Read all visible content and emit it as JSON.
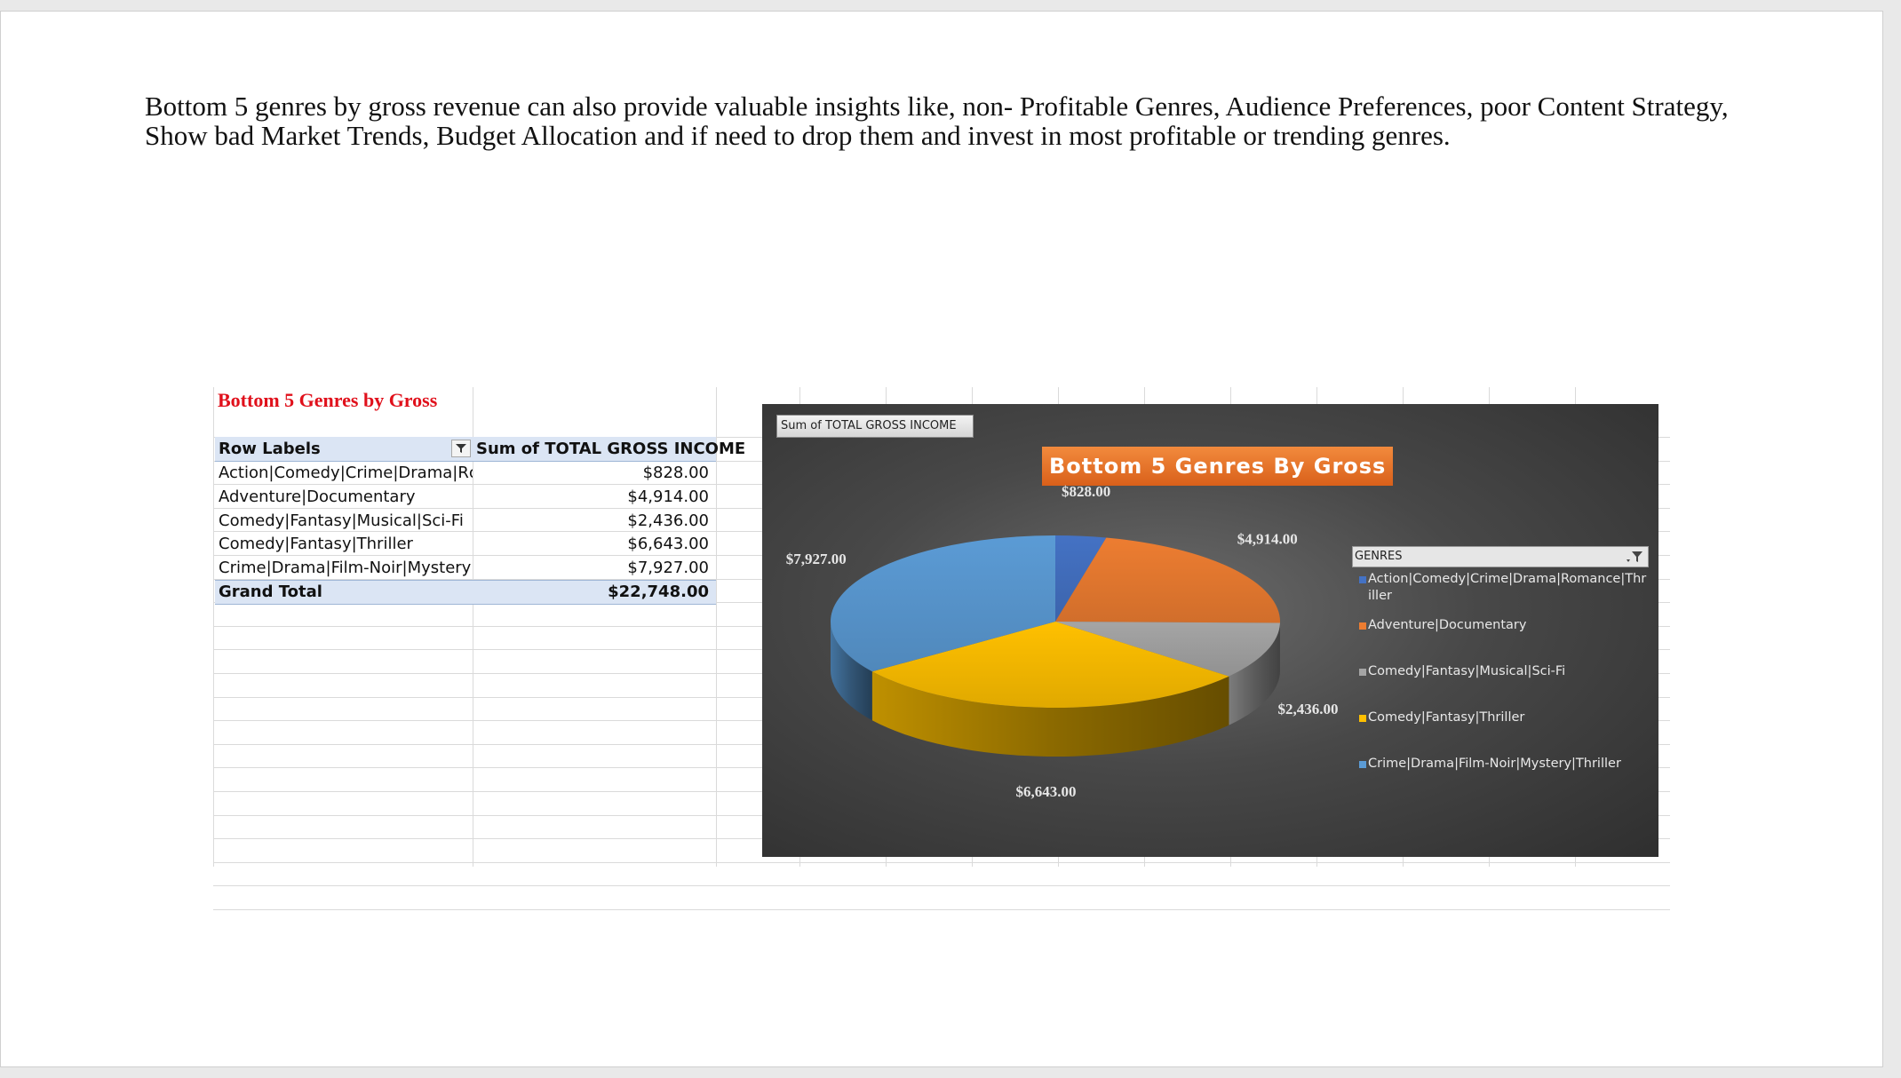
{
  "document": {
    "paragraph": "Bottom 5 genres by gross revenue can also provide valuable insights like, non- Profitable Genres, Audience Preferences, poor Content Strategy, Show bad Market Trends, Budget Allocation and if need to drop them and invest in most profitable or trending genres."
  },
  "pivot": {
    "title": "Bottom 5 Genres by Gross",
    "header": {
      "row_labels": "Row Labels",
      "value_col": "Sum of TOTAL GROSS INCOME"
    },
    "rows": [
      {
        "label": "Action|Comedy|Crime|Drama|Rc",
        "value": "$828.00"
      },
      {
        "label": "Adventure|Documentary",
        "value": "$4,914.00"
      },
      {
        "label": "Comedy|Fantasy|Musical|Sci-Fi",
        "value": "$2,436.00"
      },
      {
        "label": "Comedy|Fantasy|Thriller",
        "value": "$6,643.00"
      },
      {
        "label": "Crime|Drama|Film-Noir|Mystery",
        "value": "$7,927.00"
      }
    ],
    "total": {
      "label": "Grand Total",
      "value": "$22,748.00"
    }
  },
  "chart_data": {
    "type": "pie",
    "title": "Bottom 5 Genres By Gross",
    "field_button": "Sum of TOTAL GROSS INCOME",
    "legend_title": "GENRES",
    "legend_position": "right",
    "categories": [
      "Action|Comedy|Crime|Drama|Romance|Thriller",
      "Adventure|Documentary",
      "Comedy|Fantasy|Musical|Sci-Fi",
      "Comedy|Fantasy|Thriller",
      "Crime|Drama|Film-Noir|Mystery|Thriller"
    ],
    "values": [
      828,
      4914,
      2436,
      6643,
      7927
    ],
    "data_labels": [
      "$828.00",
      "$4,914.00",
      "$2,436.00",
      "$6,643.00",
      "$7,927.00"
    ],
    "colors": [
      "#4472c4",
      "#ed7d31",
      "#a5a5a5",
      "#ffc000",
      "#5b9bd5"
    ]
  }
}
